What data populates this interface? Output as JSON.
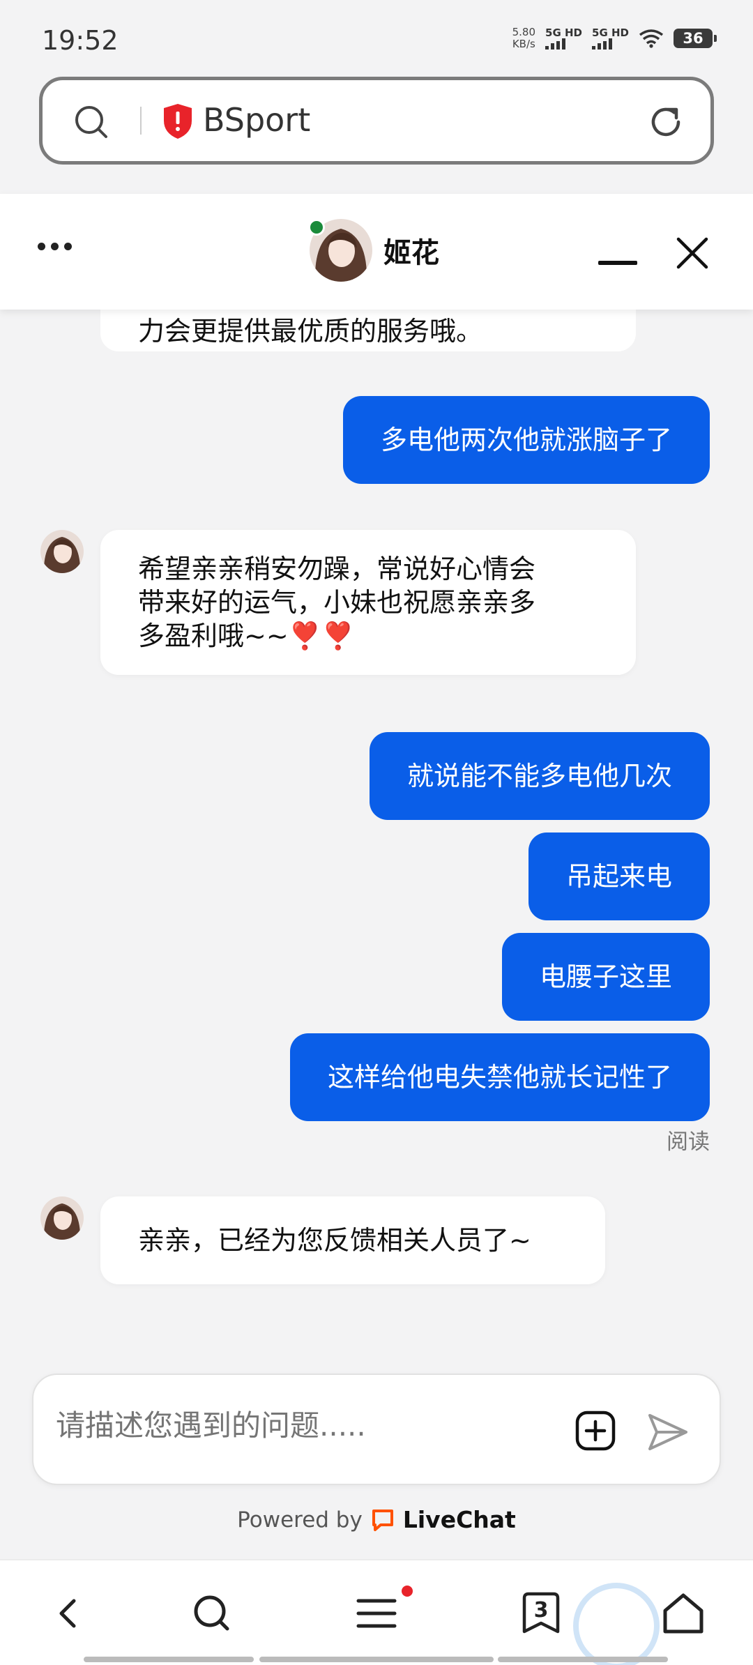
{
  "status_bar": {
    "time": "19:52",
    "net_speed_value": "5.80",
    "net_speed_unit": "KB/s",
    "sim1_label": "5G HD",
    "sim2_label": "5G HD",
    "battery": "36"
  },
  "browser": {
    "url_title": "BSport"
  },
  "chat_header": {
    "agent_name": "姬花",
    "online_color": "#1a8a3a"
  },
  "messages": [
    {
      "sender": "agent",
      "text": "力会更提供最优质的服务哦。",
      "truncated": true
    },
    {
      "sender": "user",
      "text": "多电他两次他就涨脑子了"
    },
    {
      "sender": "agent",
      "lines": [
        "希望亲亲稍安勿躁，常说好心情会",
        "带来好的运气，小妹也祝愿亲亲多",
        "多盈利哦~~❣️❣️"
      ]
    },
    {
      "sender": "user",
      "text": "就说能不能多电他几次"
    },
    {
      "sender": "user",
      "text": "吊起来电"
    },
    {
      "sender": "user",
      "text": "电腰子这里"
    },
    {
      "sender": "user",
      "text": "这样给他电失禁他就长记性了"
    },
    {
      "sender": "agent",
      "text": "亲亲，已经为您反馈相关人员了~"
    }
  ],
  "read_status": "阅读",
  "composer": {
    "placeholder": "请描述您遇到的问题.....",
    "attach_icon": "add-square-icon",
    "send_icon": "send-icon"
  },
  "powered_by": {
    "label": "Powered by",
    "brand": "LiveChat",
    "brand_color": "#ff5100"
  },
  "bottom_nav": {
    "tabs_count": "3",
    "accent": "#0a5ee8"
  }
}
